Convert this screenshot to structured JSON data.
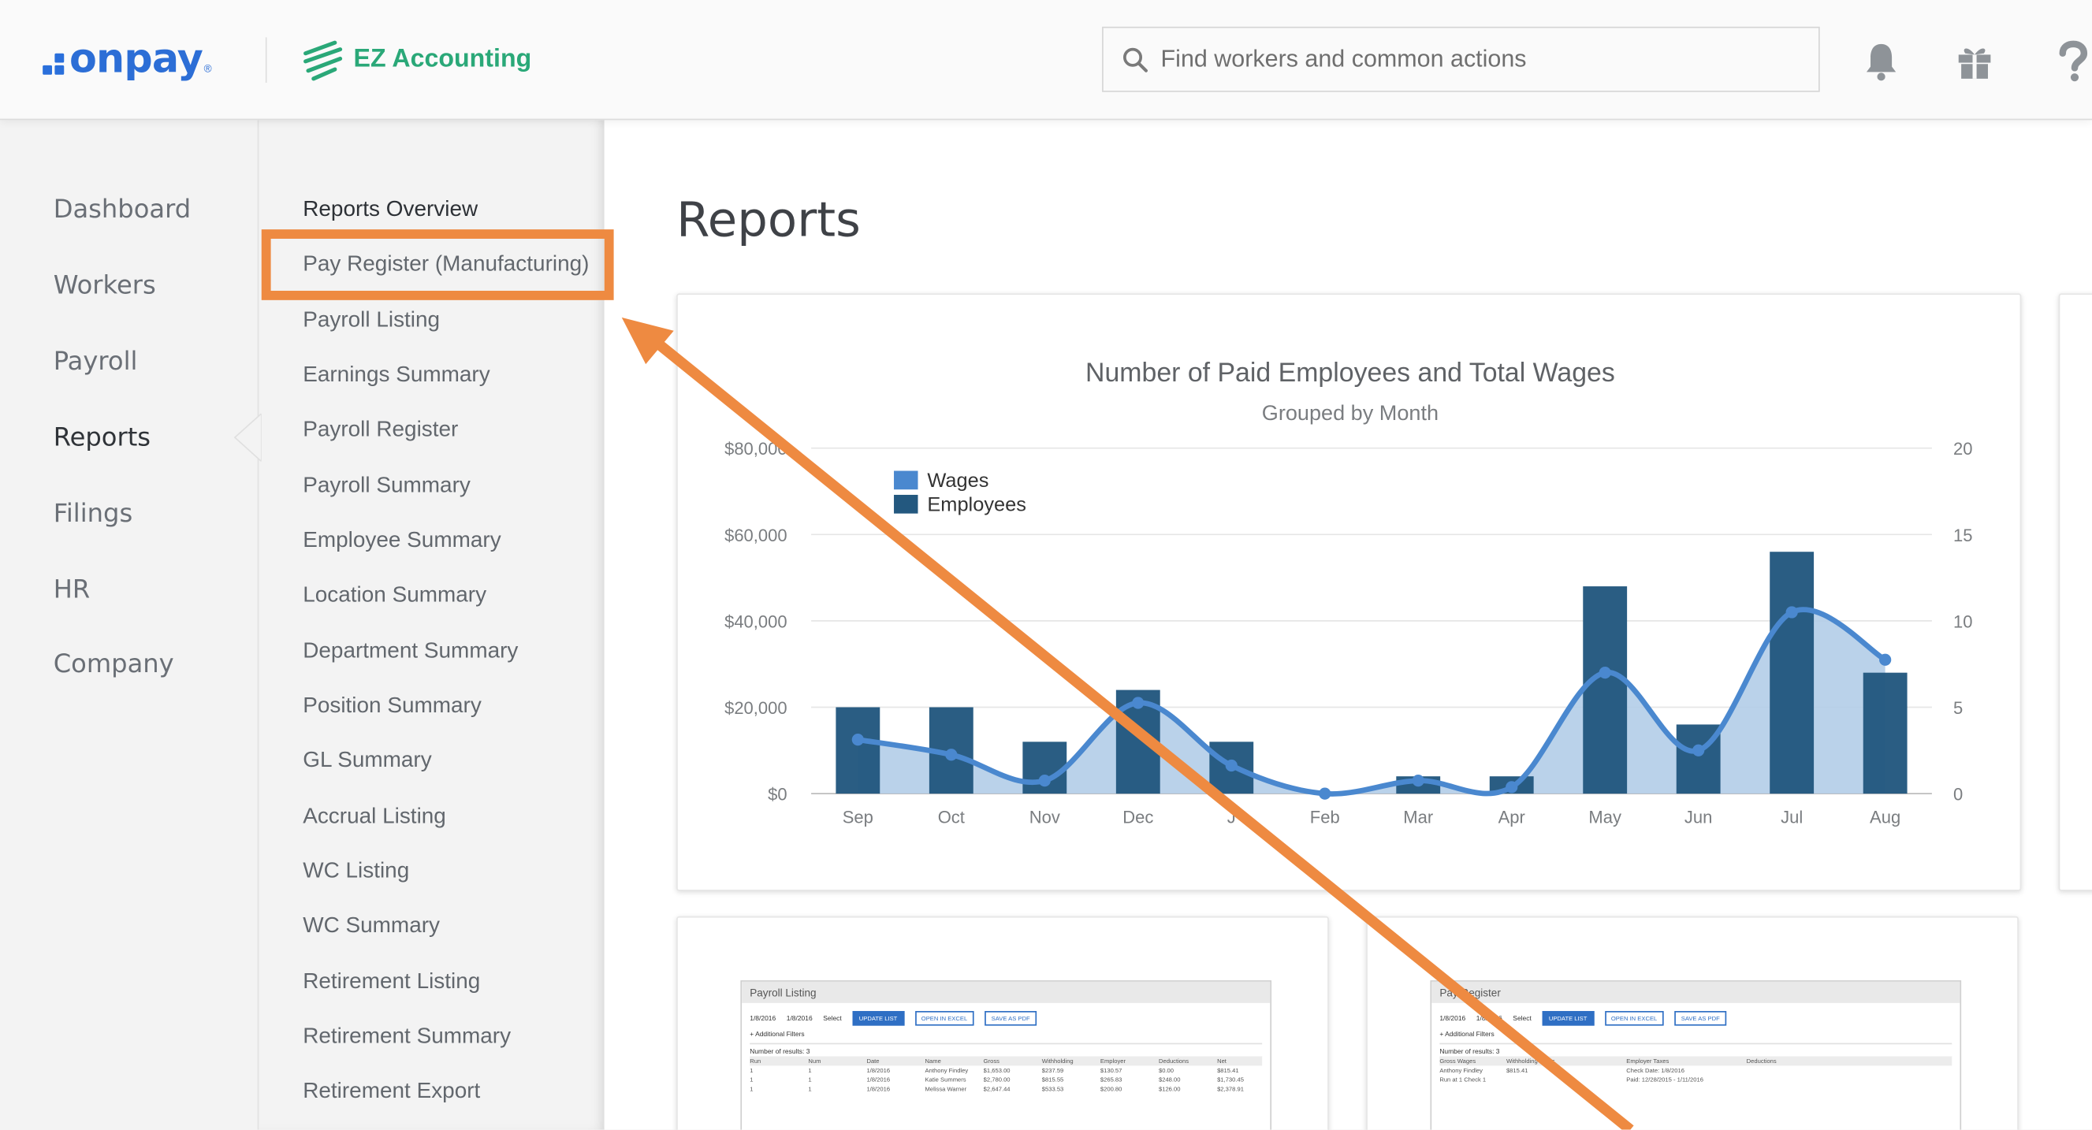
{
  "header": {
    "brand": "onpay",
    "partner": "EZ Accounting",
    "search_placeholder": "Find workers and common actions"
  },
  "sidebar": {
    "items": [
      {
        "label": "Dashboard",
        "active": false
      },
      {
        "label": "Workers",
        "active": false
      },
      {
        "label": "Payroll",
        "active": false
      },
      {
        "label": "Reports",
        "active": true
      },
      {
        "label": "Filings",
        "active": false
      },
      {
        "label": "HR",
        "active": false
      },
      {
        "label": "Company",
        "active": false
      }
    ]
  },
  "subnav": {
    "items": [
      "Reports Overview",
      "Pay Register (Manufacturing)",
      "Payroll Listing",
      "Earnings Summary",
      "Payroll Register",
      "Payroll Summary",
      "Employee Summary",
      "Location Summary",
      "Department Summary",
      "Position Summary",
      "GL Summary",
      "Accrual Listing",
      "WC Listing",
      "WC Summary",
      "Retirement Listing",
      "Retirement Summary",
      "Retirement Export"
    ],
    "highlighted": "Pay Register (Manufacturing)"
  },
  "main": {
    "title": "Reports"
  },
  "chart_data": {
    "type": "bar",
    "title": "Number of Paid Employees and Total Wages",
    "subtitle": "Grouped by Month",
    "categories": [
      "Sep",
      "Oct",
      "Nov",
      "Dec",
      "Jan",
      "Feb",
      "Mar",
      "Apr",
      "May",
      "Jun",
      "Jul",
      "Aug"
    ],
    "category_labels": [
      "Sep",
      "Oct",
      "Nov",
      "Dec",
      "J",
      "Feb",
      "Mar",
      "Apr",
      "May",
      "Jun",
      "Jul",
      "Aug"
    ],
    "series": [
      {
        "name": "Wages",
        "kind": "area",
        "axis": "left",
        "values": [
          12500,
          9000,
          3000,
          21000,
          6500,
          0,
          3000,
          1500,
          28000,
          10000,
          42000,
          31000
        ]
      },
      {
        "name": "Employees",
        "kind": "bar",
        "axis": "right",
        "values": [
          5,
          5,
          3,
          6,
          3,
          0,
          1,
          1,
          12,
          4,
          14,
          7
        ]
      }
    ],
    "ylim_left": [
      0,
      80000
    ],
    "ylim_right": [
      0,
      20
    ],
    "left_ticks": [
      "$0",
      "$20,000",
      "$40,000",
      "$60,000",
      "$80,000"
    ],
    "right_ticks": [
      "0",
      "5",
      "10",
      "15",
      "20"
    ],
    "colors": {
      "wages": "#4a88cf",
      "wages_fill": "#b3cde8",
      "employees": "#23587f"
    },
    "legend_position": "top-left",
    "grid": true
  },
  "thumbnails": [
    {
      "title": "Payroll Listing",
      "buttons": [
        "UPDATE LIST",
        "OPEN IN EXCEL",
        "SAVE AS PDF"
      ],
      "fields": [
        "1/8/2016",
        "1/8/2016",
        "Select"
      ],
      "filters": "+ Additional Filters",
      "count": "Number of results: 3",
      "columns": [
        "Run",
        "Num",
        "Date",
        "Name",
        "Gross",
        "Withholding",
        "Employer",
        "Deductions",
        "Net"
      ],
      "rows": [
        [
          "1",
          "1",
          "1/8/2016",
          "Anthony Findley",
          "$1,653.00",
          "$237.59",
          "$130.57",
          "$0.00",
          "$815.41"
        ],
        [
          "1",
          "1",
          "1/8/2016",
          "Katie Summers",
          "$2,780.00",
          "$815.55",
          "$265.83",
          "$248.00",
          "$1,730.45"
        ],
        [
          "1",
          "1",
          "1/8/2016",
          "Melissa Warner",
          "$2,647.44",
          "$533.53",
          "$200.80",
          "$126.00",
          "$2,378.91"
        ]
      ]
    },
    {
      "title": "Pay Register",
      "buttons": [
        "UPDATE LIST",
        "OPEN IN EXCEL",
        "SAVE AS PDF"
      ],
      "fields": [
        "1/8/2016",
        "1/8/2016",
        "Select"
      ],
      "filters": "+ Additional Filters",
      "count": "Number of results: 3",
      "columns": [
        "Gross Wages",
        "Withholding Taxes",
        "Employer Taxes",
        "Deductions"
      ],
      "rows": [
        [
          "Anthony Findley",
          "$815.41",
          "Check Date: 1/8/2016",
          ""
        ],
        [
          "Run at 1 Check 1",
          "",
          "Paid: 12/28/2015 - 1/11/2016",
          ""
        ]
      ]
    }
  ]
}
